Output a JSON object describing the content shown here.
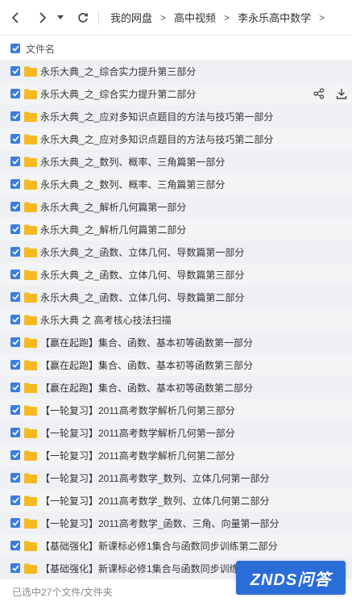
{
  "breadcrumb": {
    "items": [
      "我的网盘",
      "高中视频",
      "李永乐高中数学"
    ]
  },
  "list": {
    "header_label": "文件名",
    "rows": [
      {
        "name": "永乐大典_之_综合实力提升第三部分"
      },
      {
        "name": "永乐大典_之_综合实力提升第二部分"
      },
      {
        "name": "永乐大典_之_应对多知识点题目的方法与技巧第一部分"
      },
      {
        "name": "永乐大典_之_应对多知识点题目的方法与技巧第二部分"
      },
      {
        "name": "永乐大典_之_数列、概率、三角篇第一部分"
      },
      {
        "name": "永乐大典_之_数列、概率、三角篇第三部分"
      },
      {
        "name": "永乐大典_之_解析几何篇第一部分"
      },
      {
        "name": "永乐大典_之_解析几何篇第二部分"
      },
      {
        "name": "永乐大典_之_函数、立体几何、导数篇第一部分"
      },
      {
        "name": "永乐大典_之_函数、立体几何、导数篇第三部分"
      },
      {
        "name": "永乐大典_之_函数、立体几何、导数篇第二部分"
      },
      {
        "name": "永乐大典 之 高考核心技法扫描"
      },
      {
        "name": "【赢在起跑】集合、函数、基本初等函数第一部分"
      },
      {
        "name": "【赢在起跑】集合、函数、基本初等函数第三部分"
      },
      {
        "name": "【赢在起跑】集合、函数、基本初等函数第二部分"
      },
      {
        "name": "【一轮复习】2011高考数学解析几何第三部分"
      },
      {
        "name": "【一轮复习】2011高考数学解析几何第一部分"
      },
      {
        "name": "【一轮复习】2011高考数学解析几何第二部分"
      },
      {
        "name": "【一轮复习】2011高考数学_数列、立体几何第一部分"
      },
      {
        "name": "【一轮复习】2011高考数学_数列、立体几何第二部分"
      },
      {
        "name": "【一轮复习】2011高考数学_函数、三角、向量第一部分"
      },
      {
        "name": "【基础强化】新课标必修1集合与函数同步训练第二部分"
      },
      {
        "name": "【基础强化】新课标必修1集合与函数同步训练第一部分"
      }
    ]
  },
  "status": {
    "text": "已选中27个文件/文件夹"
  },
  "watermark": {
    "text": "ZNDS问答"
  },
  "colors": {
    "accent": "#3b7ddd",
    "folder": "#f5b923",
    "row_bg": "#f0f2f5"
  },
  "icons": {
    "back": "chevron-left-icon",
    "forward": "chevron-right-icon",
    "history": "caret-down-icon",
    "refresh": "refresh-icon",
    "share": "share-icon",
    "download": "download-icon",
    "folder": "folder-icon"
  }
}
